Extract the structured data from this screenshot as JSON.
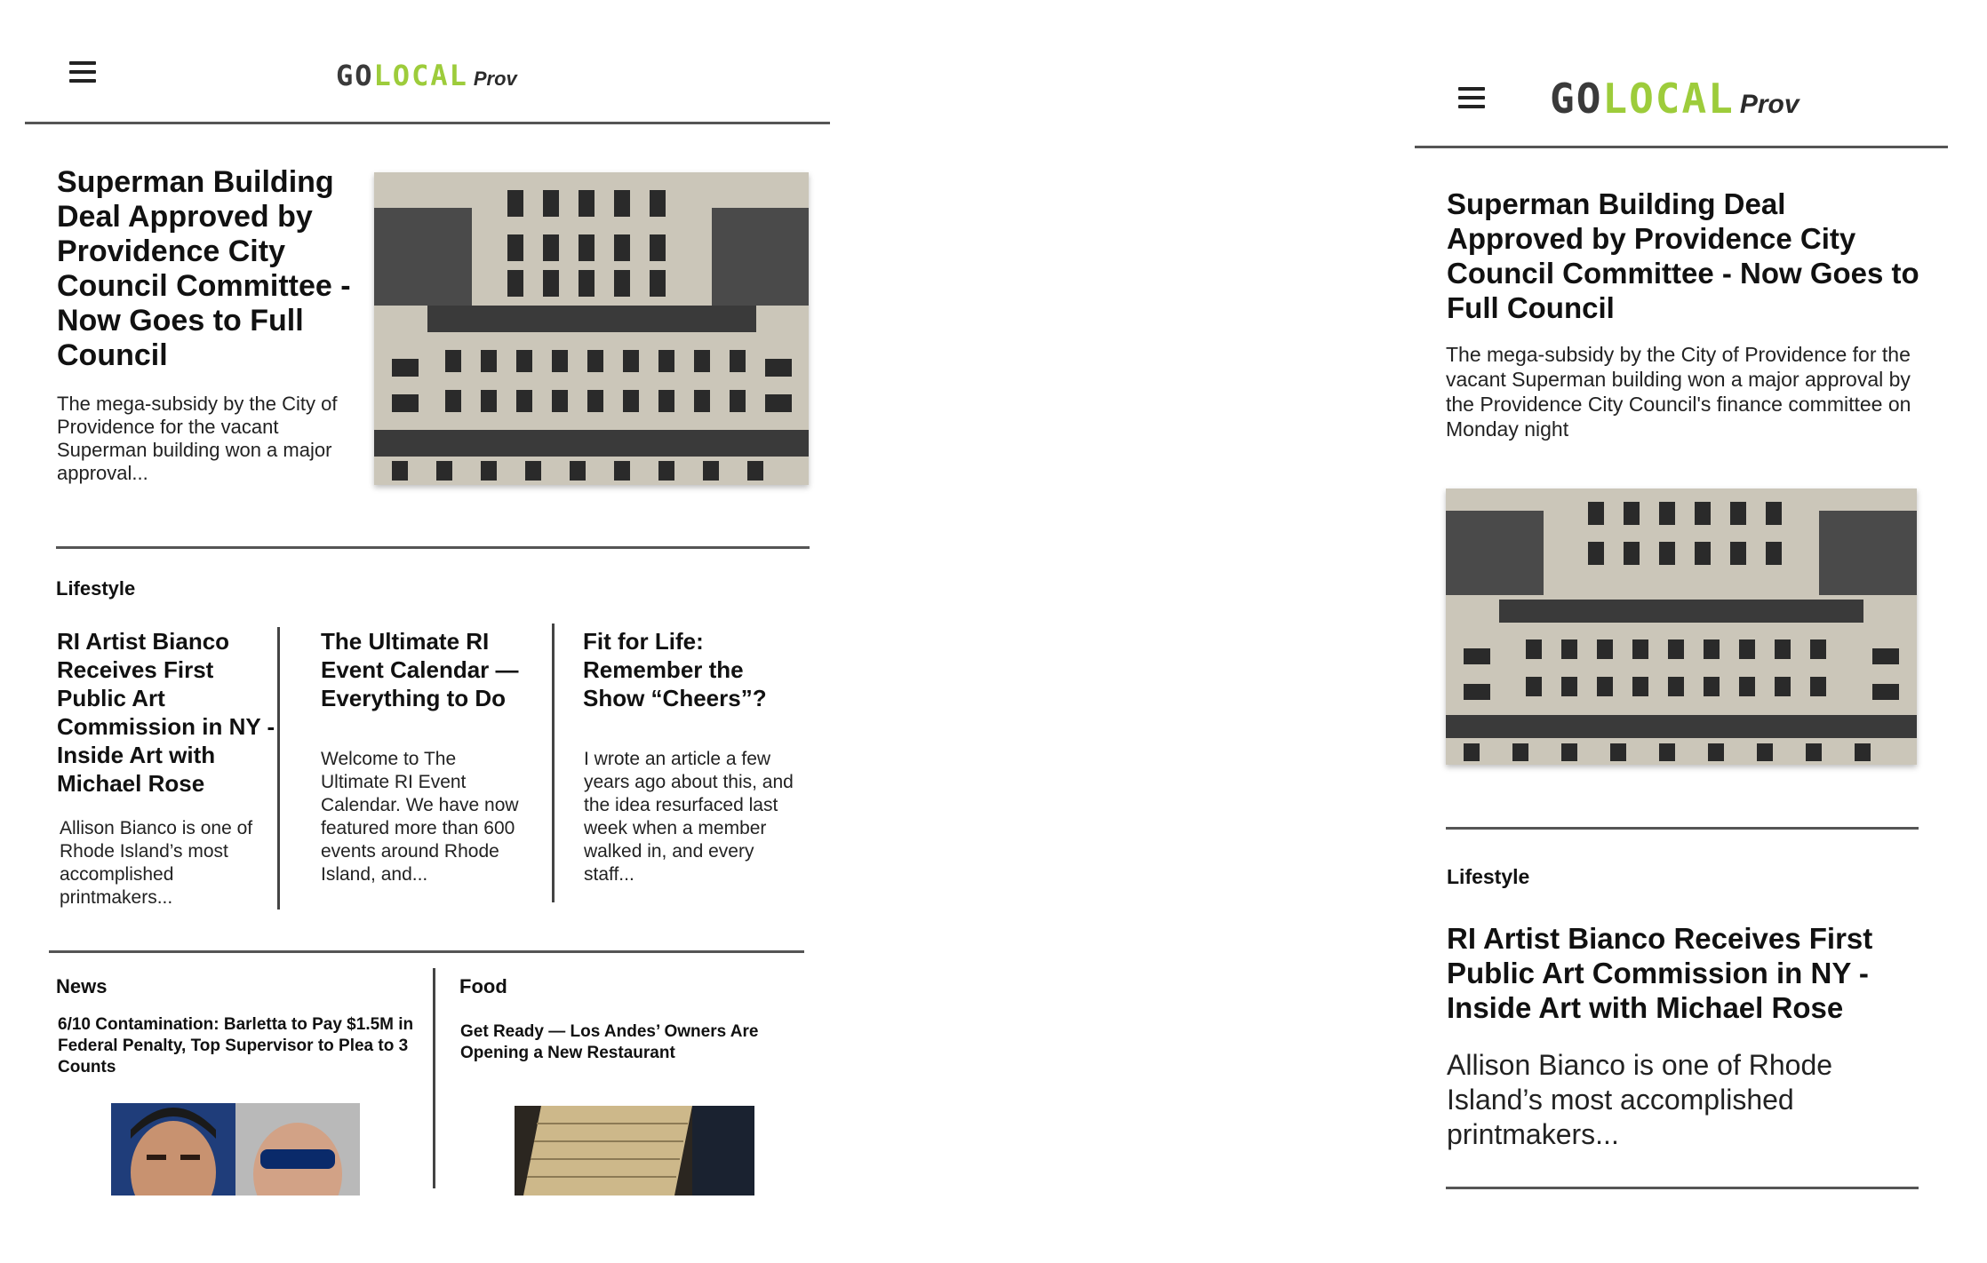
{
  "left": {
    "logo": {
      "go": "GO",
      "local": "LOCAL",
      "prov": "Prov"
    },
    "lead": {
      "title": "Superman Building Deal Approved by Providence City Council Committee - Now Goes to Full Council",
      "dek": "The mega-subsidy by the City of Providence for the vacant Superman building won a major approval..."
    },
    "lifestyle": {
      "label": "Lifestyle",
      "articles": [
        {
          "title": "RI Artist Bianco Receives First Public Art Commission in NY - Inside Art with Michael Rose",
          "dek": "Allison Bianco is one of Rhode Island’s most accomplished printmakers..."
        },
        {
          "title": "The Ultimate RI Event Calendar — Everything to Do",
          "dek": "Welcome to The Ultimate RI Event Calendar.  We have now featured more than 600 events around Rhode Island, and..."
        },
        {
          "title": "Fit for Life: Remember the Show “Cheers”?",
          "dek": "I wrote an article a few years ago about this, and the idea resurfaced last week when a member walked in, and every staff..."
        }
      ]
    },
    "news": {
      "label": "News",
      "title": "6/10 Contamination: Barletta to Pay $1.5M in Federal Penalty, Top Supervisor to Plea to 3 Counts"
    },
    "food": {
      "label": "Food",
      "title": "Get Ready — Los Andes’ Owners Are Opening a New Restaurant"
    }
  },
  "right": {
    "logo": {
      "go": "GO",
      "local": "LOCAL",
      "prov": "Prov"
    },
    "lead": {
      "title": "Superman Building Deal Approved by Providence City Council Committee - Now Goes to Full Council",
      "dek": "The mega-subsidy by the City of Providence for the vacant Superman building won a major approval by the Providence City Council's finance committee on Monday night"
    },
    "lifestyle": {
      "label": "Lifestyle",
      "title": "RI Artist Bianco Receives First Public Art Commission in NY - Inside Art with Michael Rose",
      "dek": "Allison Bianco is one of Rhode Island’s most accomplished printmakers..."
    }
  },
  "colors": {
    "logo_green": "#9dcc3b",
    "logo_gray": "#3a3a3a",
    "rule": "#555555"
  }
}
